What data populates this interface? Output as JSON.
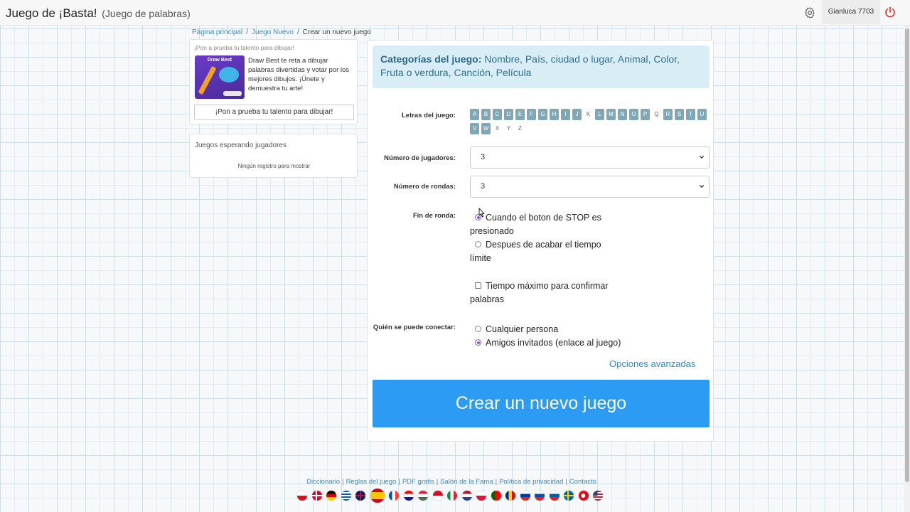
{
  "header": {
    "title": "Juego de ¡Basta!",
    "subtitle": "(Juego de palabras)",
    "user": "Gianluca 7703",
    "settings_icon": "gear-icon",
    "logout_icon": "power-icon"
  },
  "breadcrumb": {
    "home": "Página principal",
    "new_game": "Juego Nuevo",
    "current": "Crear un nuevo juego",
    "separator": "/"
  },
  "promo": {
    "heading": "¡Pon a prueba tu talento para dibujar!",
    "image_title": "Draw Best",
    "text": "Draw Best te reta a dibujar palabras divertidas y votar por los mejores dibujos. ¡Únete y demuestra tu arte!",
    "button": "¡Pon a prueba tu talento para dibujar!"
  },
  "waiting": {
    "title": "Juegos esperando jugadores",
    "empty": "Ningún registro para mostrar"
  },
  "form": {
    "categories_label": "Categorías del juego:",
    "categories_value": "Nombre, País, ciudad o lugar, Animal, Color, Fruta o verdura, Canción, Película",
    "letters_label": "Letras del juego:",
    "letters": [
      {
        "l": "A",
        "on": true
      },
      {
        "l": "B",
        "on": true
      },
      {
        "l": "C",
        "on": true
      },
      {
        "l": "D",
        "on": true
      },
      {
        "l": "E",
        "on": true
      },
      {
        "l": "F",
        "on": true
      },
      {
        "l": "G",
        "on": true
      },
      {
        "l": "H",
        "on": true
      },
      {
        "l": "I",
        "on": true
      },
      {
        "l": "J",
        "on": true
      },
      {
        "l": "K",
        "on": false
      },
      {
        "l": "L",
        "on": true
      },
      {
        "l": "M",
        "on": true
      },
      {
        "l": "N",
        "on": true
      },
      {
        "l": "O",
        "on": true
      },
      {
        "l": "P",
        "on": true
      },
      {
        "l": "Q",
        "on": false
      },
      {
        "l": "R",
        "on": true
      },
      {
        "l": "S",
        "on": true
      },
      {
        "l": "T",
        "on": true
      },
      {
        "l": "U",
        "on": true
      },
      {
        "l": "V",
        "on": true
      },
      {
        "l": "W",
        "on": true
      },
      {
        "l": "X",
        "on": false
      },
      {
        "l": "Y",
        "on": false
      },
      {
        "l": "Z",
        "on": false
      }
    ],
    "players_label": "Número de jugadores:",
    "players_value": "3",
    "rounds_label": "Número de rondas:",
    "rounds_value": "3",
    "end_round_label": "Fin de ronda:",
    "end_round_option1": "Cuando el boton de STOP es presionado",
    "end_round_option2": "Despues de acabar el tiempo límite",
    "end_round_selected": 1,
    "max_time_label": "Tiempo máximo para confirmar palabras",
    "max_time_checked": false,
    "who_label": "Quién se puede conectar:",
    "who_option1": "Cualquier persona",
    "who_option2": "Amigos invitados (enlace al juego)",
    "who_selected": 2,
    "advanced": "Opciones avanzadas",
    "submit": "Crear un nuevo juego"
  },
  "footer": {
    "links": [
      "Diccionario",
      "Reglas del juego",
      "PDF gratis",
      "Salón de la Fama",
      "Política de privacidad",
      "Contacto"
    ],
    "separator": "|",
    "flags": [
      "cz",
      "dk",
      "de",
      "gr",
      "gb",
      "es",
      "fr",
      "hr",
      "hu",
      "id",
      "it",
      "nl",
      "pl",
      "pt",
      "ro",
      "ru",
      "sk",
      "si",
      "se",
      "tr",
      "us"
    ],
    "active_flag": "es"
  },
  "colors": {
    "accent": "#2b9bf4",
    "info_bg": "#d9edf7",
    "letter_on": "#7fa7b6",
    "radio": "#8a5cd8",
    "logout": "#e0312f"
  }
}
